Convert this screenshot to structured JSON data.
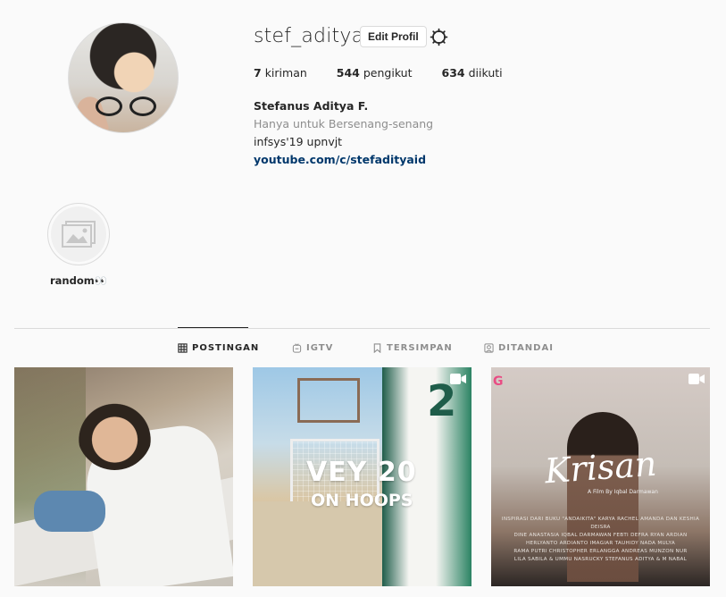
{
  "profile": {
    "username": "stef_aditya",
    "edit_label": "Edit Profil",
    "stats": {
      "posts_count": "7",
      "posts_label": "kiriman",
      "followers_count": "544",
      "followers_label": "pengikut",
      "following_count": "634",
      "following_label": "diikuti"
    },
    "bio": {
      "name": "Stefanus Aditya F.",
      "category": "Hanya untuk Bersenang-senang",
      "line": "infsys'19 upnvjt",
      "link": "youtube.com/c/stefadityaid"
    }
  },
  "highlights": [
    {
      "label": "random👀",
      "icon": "image-icon"
    }
  ],
  "tabs": [
    {
      "label": "POSTINGAN",
      "icon": "grid-icon",
      "active": true
    },
    {
      "label": "IGTV",
      "icon": "igtv-icon",
      "active": false
    },
    {
      "label": "TERSIMPAN",
      "icon": "bookmark-icon",
      "active": false
    },
    {
      "label": "DITANDAI",
      "icon": "tagged-icon",
      "active": false
    }
  ],
  "posts": [
    {
      "type": "photo",
      "has_video_icon": false
    },
    {
      "type": "video",
      "has_video_icon": true,
      "overlay_line1": "VEY 20",
      "overlay_line2": "ON HOOPS",
      "jersey_number": "2"
    },
    {
      "type": "video",
      "has_video_icon": true,
      "badge": "G",
      "film_title": "Krisan",
      "film_subtitle": "A Film By Iqbal Darmawan",
      "credits": "INSPIRASI DARI BUKU \"ANDAIKITA\" KARYA RACHEL AMANDA DAN KESHIA DEISRA\nDINE ANASTASIA  IQBAL DARMAWAN  FEBTI DEFRA  RYAN ARDIAN\nHERLYANTO ARDIANTO  IMAGIAR TAUHIDY  NADA MULYA\nRAMA PUTRI  CHRISTOPHER ERLANGGA  ANDREAS  MUNZON NUR\nLILA SABILA & UMMU NASRUCKY  STEFANUS ADITYA & M NABAL"
    }
  ],
  "colors": {
    "background": "#fafafa",
    "text": "#262626",
    "muted": "#8e8e8e",
    "link": "#00376b",
    "border": "#dbdbdb"
  }
}
